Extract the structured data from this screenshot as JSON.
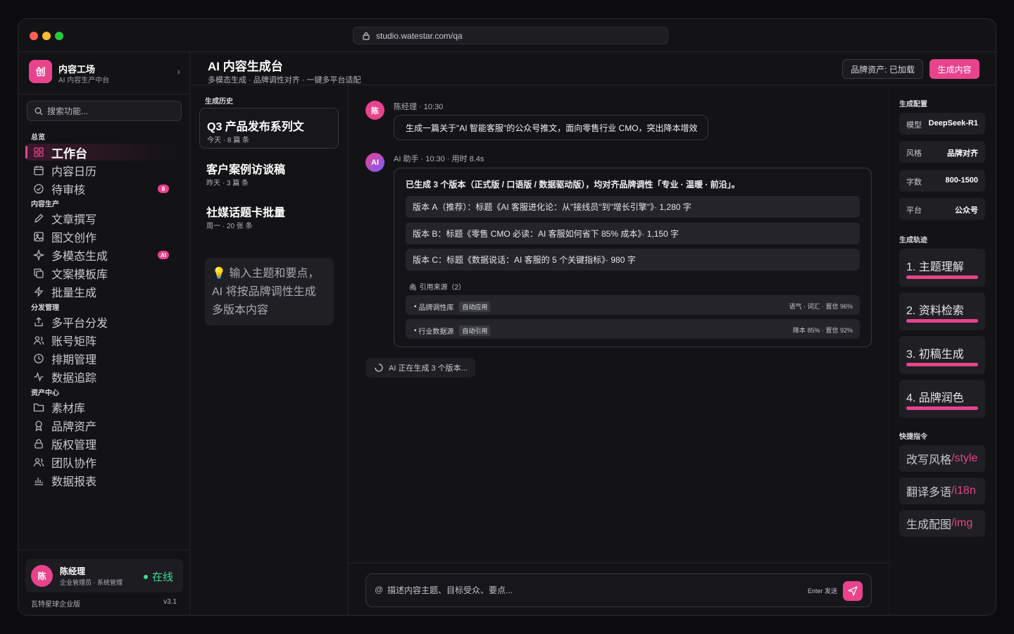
{
  "browser": {
    "url": "studio.watestar.com/qa"
  },
  "brand": {
    "logo": "创",
    "name": "内容工场",
    "sub": "AI 内容生产中台"
  },
  "search": {
    "placeholder": "搜索功能..."
  },
  "sections": {
    "overview": "总览",
    "production": "内容生产",
    "distribution": "分发管理",
    "assets": "资产中心"
  },
  "nav": {
    "overview": [
      {
        "label": "工作台",
        "icon": "grid-icon"
      },
      {
        "label": "内容日历",
        "icon": "calendar-icon"
      },
      {
        "label": "待审核",
        "icon": "check-circle-icon",
        "badge": "8"
      }
    ],
    "production": [
      {
        "label": "文章撰写",
        "icon": "pen-icon"
      },
      {
        "label": "图文创作",
        "icon": "image-icon"
      },
      {
        "label": "多模态生成",
        "icon": "sparkle-icon",
        "badge": "AI"
      },
      {
        "label": "文案模板库",
        "icon": "copy-icon"
      },
      {
        "label": "批量生成",
        "icon": "bolt-icon"
      }
    ],
    "distribution": [
      {
        "label": "多平台分发",
        "icon": "share-icon"
      },
      {
        "label": "账号矩阵",
        "icon": "users-icon"
      },
      {
        "label": "排期管理",
        "icon": "clock-icon"
      },
      {
        "label": "数据追踪",
        "icon": "activity-icon"
      }
    ],
    "assets": [
      {
        "label": "素材库",
        "icon": "folder-icon"
      },
      {
        "label": "品牌资产",
        "icon": "award-icon"
      },
      {
        "label": "版权管理",
        "icon": "lock-icon"
      },
      {
        "label": "团队协作",
        "icon": "team-icon"
      },
      {
        "label": "数据报表",
        "icon": "bar-chart-icon"
      }
    ]
  },
  "user": {
    "avatar": "陈",
    "name": "陈经理",
    "role": "企业管理员 · 系统管理",
    "status": "在线"
  },
  "footer": {
    "org": "瓦特星球企业版",
    "version": "v3.1"
  },
  "header": {
    "title": "AI 内容生成台",
    "subtitle": "多模态生成 · 品牌调性对齐 · 一键多平台适配",
    "assets_button": "品牌资产: 已加载",
    "generate_button": "生成内容"
  },
  "history": {
    "label": "生成历史",
    "items": [
      {
        "title": "Q3 产品发布系列文",
        "meta": "今天 · 8 篇 条"
      },
      {
        "title": "客户案例访谈稿",
        "meta": "昨天 · 3 篇 条"
      },
      {
        "title": "社媒话题卡批量",
        "meta": "周一 · 20 张 条"
      }
    ],
    "hint": "💡 输入主题和要点，AI 将按品牌调性生成多版本内容"
  },
  "chat": {
    "user_msg": {
      "avatar": "陈",
      "meta": "陈经理 · 10:30",
      "text": "生成一篇关于\"AI 智能客服\"的公众号推文，面向零售行业 CMO，突出降本增效"
    },
    "ai_msg": {
      "avatar": "AI",
      "meta": "AI 助手 · 10:30 · 用时 8.4s",
      "summary": "已生成 3 个版本（正式版 / 口语版 / 数据驱动版），均对齐品牌调性「专业 · 温暖 · 前沿」。",
      "versions": [
        "版本 A（推荐）：标题《AI 客服进化论：从\"接线员\"到\"增长引擎\"》· 1,280 字",
        "版本 B：标题《零售 CMO 必读：AI 客服如何省下 85% 成本》· 1,150 字",
        "版本 C：标题《数据说话：AI 客服的 5 个关键指标》· 980 字"
      ],
      "citations_label": "引用来源（2）",
      "citations": [
        {
          "name": "品牌调性库",
          "tag": "自动应用",
          "stat": "语气 · 词汇 · 置信 96%"
        },
        {
          "name": "行业数据源",
          "tag": "自动引用",
          "stat": "降本 85% · 置信 92%"
        }
      ]
    },
    "loading": "AI 正在生成 3 个版本...",
    "composer": {
      "at": "@",
      "placeholder": "描述内容主题、目标受众、要点...",
      "hint": "Enter 发送"
    }
  },
  "config": {
    "label": "生成配置",
    "rows": [
      {
        "key": "模型",
        "value": "DeepSeek-R1"
      },
      {
        "key": "风格",
        "value": "品牌对齐"
      },
      {
        "key": "字数",
        "value": "800-1500"
      },
      {
        "key": "平台",
        "value": "公众号"
      }
    ]
  },
  "steps": {
    "label": "生成轨迹",
    "items": [
      {
        "name": "1. 主题理解",
        "progress": 1.0
      },
      {
        "name": "2. 资料检索",
        "progress": 1.0
      },
      {
        "name": "3. 初稿生成",
        "progress": 1.0
      },
      {
        "name": "4. 品牌润色",
        "progress": 1.0
      }
    ]
  },
  "commands": {
    "label": "快捷指令",
    "items": [
      {
        "label": "改写风格",
        "suffix": "/style"
      },
      {
        "label": "翻译多语",
        "suffix": "/i18n"
      },
      {
        "label": "生成配图 ",
        "suffix": "/img"
      }
    ]
  },
  "colors": {
    "accent": "#e8438c",
    "online": "#3ddc97",
    "ai_gradient": [
      "#e8438c",
      "#7b5cff"
    ]
  }
}
